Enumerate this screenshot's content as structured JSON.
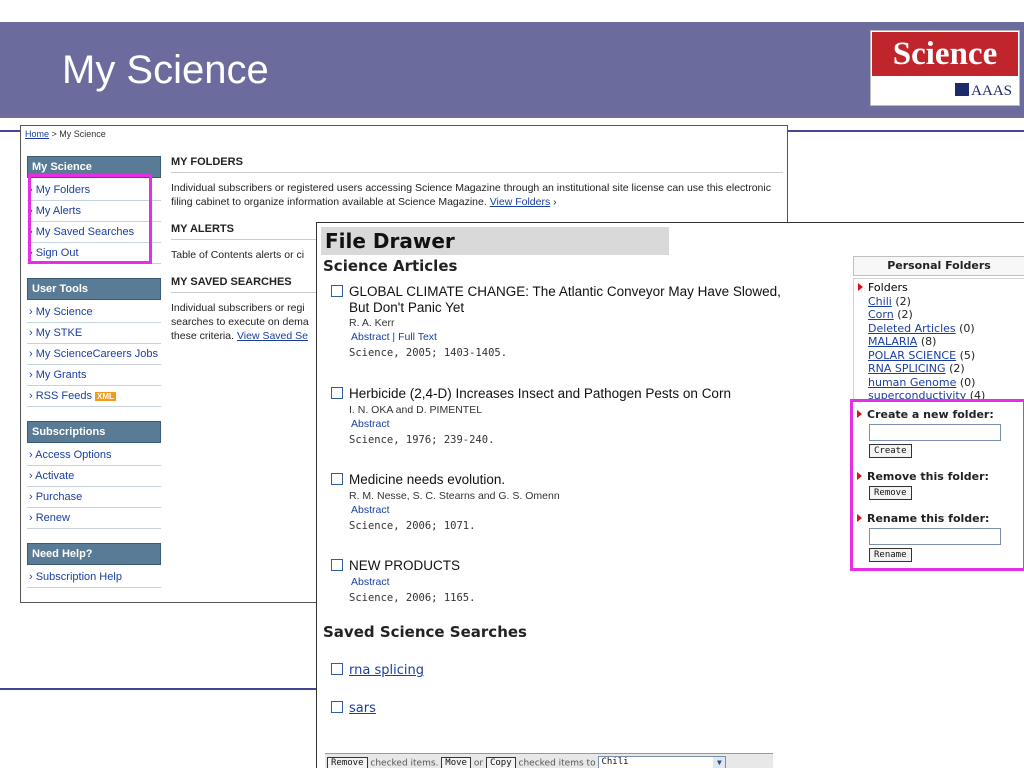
{
  "slide": {
    "title": "My Science",
    "logo_top": "Science",
    "logo_bottom": "AAAS"
  },
  "site": {
    "breadcrumb_home": "Home",
    "breadcrumb_current": " > My Science",
    "nav": [
      {
        "head": "My Science",
        "items": [
          "› My Folders",
          "› My Alerts",
          "› My Saved Searches",
          "› Sign Out"
        ]
      },
      {
        "head": "User Tools",
        "items": [
          "› My Science",
          "› My STKE",
          "› My ScienceCareers Jobs",
          "› My Grants",
          "› RSS Feeds"
        ]
      },
      {
        "head": "Subscriptions",
        "items": [
          "› Access Options",
          "› Activate",
          "› Purchase",
          "› Renew"
        ]
      },
      {
        "head": "Need Help?",
        "items": [
          "› Subscription Help"
        ]
      }
    ],
    "xml_badge": "XML",
    "sections": [
      {
        "title": "MY FOLDERS",
        "text": "Individual subscribers or registered users accessing Science Magazine through an institutional site license can use this electronic filing cabinet to organize information available at Science Magazine.",
        "link": "View Folders"
      },
      {
        "title": "MY ALERTS",
        "text": "Table of Contents alerts or ci",
        "link": ""
      },
      {
        "title": "MY SAVED SEARCHES",
        "text": "Individual subscribers or regi searches to execute on dema these criteria.",
        "link": "View Saved Se"
      }
    ]
  },
  "drawer": {
    "title": "File Drawer",
    "articles_heading": "Science Articles",
    "articles": [
      {
        "title_line1": "GLOBAL CLIMATE CHANGE: The Atlantic Conveyor May Have Slowed,",
        "title_line2": "But Don't Panic Yet",
        "authors": "R. A. Kerr",
        "links": "Abstract | Full Text",
        "citation": "Science, 2005; 1403-1405."
      },
      {
        "title_line1": "Herbicide (2,4-D) Increases Insect and Pathogen Pests on Corn",
        "title_line2": "",
        "authors": "I. N. OKA and D. PIMENTEL",
        "links": "Abstract",
        "citation": "Science, 1976; 239-240."
      },
      {
        "title_line1": "Medicine needs evolution.",
        "title_line2": "",
        "authors": "R. M. Nesse, S. C. Stearns and G. S. Omenn",
        "links": "Abstract",
        "citation": "Science, 2006; 1071."
      },
      {
        "title_line1": "NEW PRODUCTS",
        "title_line2": "",
        "authors": "",
        "links": "Abstract",
        "citation": "Science, 2006; 1165."
      }
    ],
    "searches_heading": "Saved Science Searches",
    "searches": [
      "rna splicing",
      "sars"
    ],
    "bottom": {
      "remove_btn": "Remove",
      "checked_items": "checked items.",
      "move_btn": "Move",
      "or": "or",
      "copy_btn": "Copy",
      "checked_to": "checked items to",
      "target_folder": "Chili"
    }
  },
  "personal_folders": {
    "header": "Personal Folders",
    "folders_label": "Folders",
    "folders": [
      {
        "name": "Chili",
        "count": "(2)"
      },
      {
        "name": "Corn",
        "count": "(2)"
      },
      {
        "name": "Deleted Articles",
        "count": "(0)"
      },
      {
        "name": "MALARIA",
        "count": "(8)"
      },
      {
        "name": "POLAR SCIENCE",
        "count": "(5)"
      },
      {
        "name": "RNA SPLICING",
        "count": "(2)"
      },
      {
        "name": "human Genome",
        "count": "(0)"
      },
      {
        "name": "superconductivity",
        "count": "(4)"
      }
    ],
    "create_label": "Create a new folder:",
    "create_btn": "Create",
    "remove_label": "Remove this folder:",
    "remove_btn": "Remove",
    "rename_label": "Rename this folder:",
    "rename_btn": "Rename"
  },
  "colors": {
    "header_band": "#6b6b9e",
    "highlight": "#e62ee6",
    "nav_head": "#5a7b95",
    "link": "#1a3fa0"
  }
}
